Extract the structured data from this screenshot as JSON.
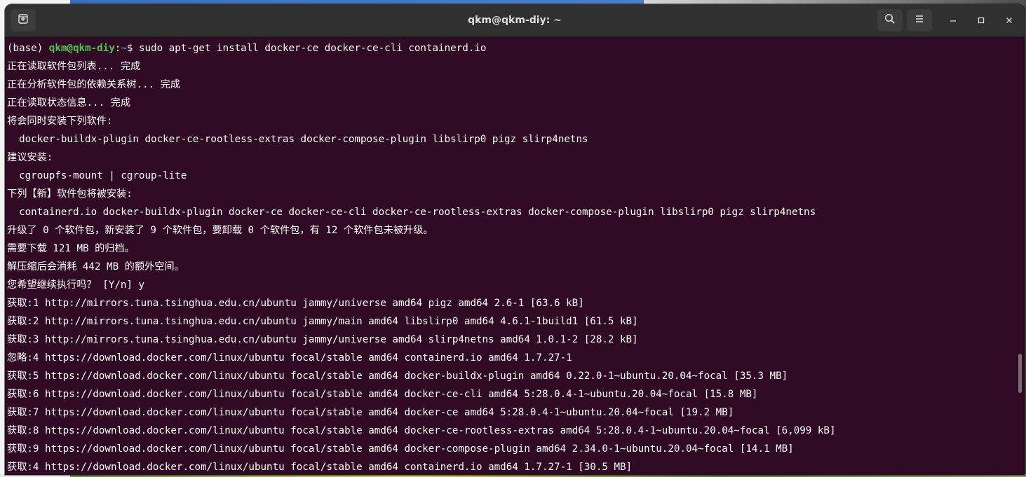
{
  "window": {
    "title": "qkm@qkm-diy: ~"
  },
  "prompt": {
    "env": "(base) ",
    "user_host": "qkm@qkm-diy",
    "colon": ":",
    "path": "~",
    "symbol": "$ ",
    "command": "sudo apt-get install docker-ce docker-ce-cli containerd.io"
  },
  "output": [
    "正在读取软件包列表... 完成",
    "正在分析软件包的依赖关系树... 完成",
    "正在读取状态信息... 完成",
    "将会同时安装下列软件:",
    "  docker-buildx-plugin docker-ce-rootless-extras docker-compose-plugin libslirp0 pigz slirp4netns",
    "建议安装:",
    "  cgroupfs-mount | cgroup-lite",
    "下列【新】软件包将被安装:",
    "  containerd.io docker-buildx-plugin docker-ce docker-ce-cli docker-ce-rootless-extras docker-compose-plugin libslirp0 pigz slirp4netns",
    "升级了 0 个软件包，新安装了 9 个软件包，要卸载 0 个软件包，有 12 个软件包未被升级。",
    "需要下载 121 MB 的归档。",
    "解压缩后会消耗 442 MB 的额外空间。",
    "您希望继续执行吗？ [Y/n] y",
    "获取:1 http://mirrors.tuna.tsinghua.edu.cn/ubuntu jammy/universe amd64 pigz amd64 2.6-1 [63.6 kB]",
    "获取:2 http://mirrors.tuna.tsinghua.edu.cn/ubuntu jammy/main amd64 libslirp0 amd64 4.6.1-1build1 [61.5 kB]",
    "获取:3 http://mirrors.tuna.tsinghua.edu.cn/ubuntu jammy/universe amd64 slirp4netns amd64 1.0.1-2 [28.2 kB]",
    "忽略:4 https://download.docker.com/linux/ubuntu focal/stable amd64 containerd.io amd64 1.7.27-1",
    "获取:5 https://download.docker.com/linux/ubuntu focal/stable amd64 docker-buildx-plugin amd64 0.22.0-1~ubuntu.20.04~focal [35.3 MB]",
    "获取:6 https://download.docker.com/linux/ubuntu focal/stable amd64 docker-ce-cli amd64 5:28.0.4-1~ubuntu.20.04~focal [15.8 MB]",
    "获取:7 https://download.docker.com/linux/ubuntu focal/stable amd64 docker-ce amd64 5:28.0.4-1~ubuntu.20.04~focal [19.2 MB]",
    "获取:8 https://download.docker.com/linux/ubuntu focal/stable amd64 docker-ce-rootless-extras amd64 5:28.0.4-1~ubuntu.20.04~focal [6,099 kB]",
    "获取:9 https://download.docker.com/linux/ubuntu focal/stable amd64 docker-compose-plugin amd64 2.34.0-1~ubuntu.20.04~focal [14.1 MB]",
    "获取:4 https://download.docker.com/linux/ubuntu focal/stable amd64 containerd.io amd64 1.7.27-1 [30.5 MB]"
  ],
  "colors": {
    "terminal_bg": "#300a24",
    "terminal_fg": "#ffffff",
    "prompt_user": "#4fc34f",
    "prompt_path": "#5a8fd0",
    "titlebar_bg": "#303030"
  },
  "icons": {
    "new_tab": "new-tab-icon",
    "search": "search-icon",
    "menu": "hamburger-menu-icon",
    "minimize": "minimize-icon",
    "maximize": "maximize-icon",
    "close": "close-icon"
  }
}
